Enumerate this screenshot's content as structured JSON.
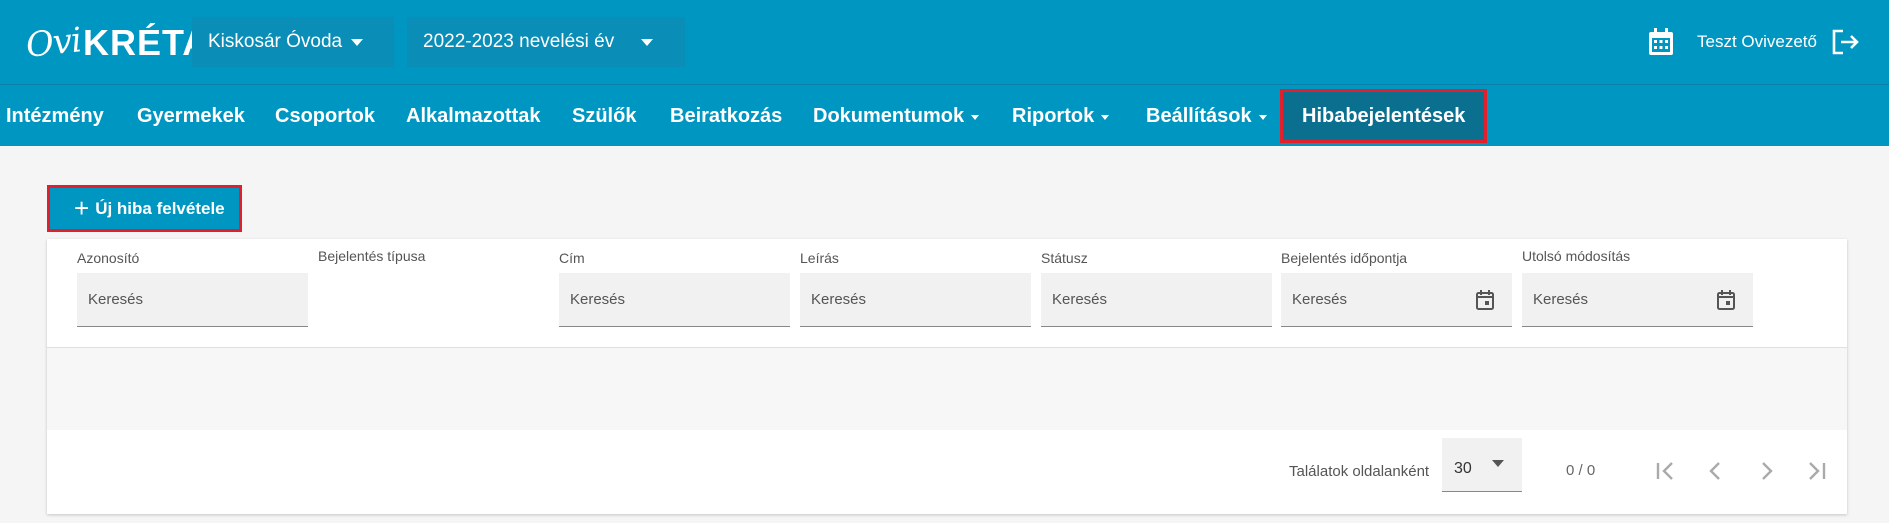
{
  "header": {
    "school_selector": "Kiskosár Óvoda",
    "year_selector": "2022-2023 nevelési év",
    "user_name": "Teszt Ovivezető",
    "logo_prefix": "Ovi",
    "logo_name": "KRÉTA"
  },
  "nav": {
    "items": [
      {
        "label": "Intézmény"
      },
      {
        "label": "Gyermekek"
      },
      {
        "label": "Csoportok"
      },
      {
        "label": "Alkalmazottak"
      },
      {
        "label": "Szülők"
      },
      {
        "label": "Beiratkozás"
      },
      {
        "label": "Dokumentumok"
      },
      {
        "label": "Riportok"
      },
      {
        "label": "Beállítások"
      },
      {
        "label": "Hibabejelentések"
      }
    ]
  },
  "toolbar": {
    "add_label": "Új hiba felvétele"
  },
  "table": {
    "columns": [
      {
        "label": "Azonosító",
        "placeholder": "Keresés"
      },
      {
        "label": "Bejelentés típusa",
        "placeholder": ""
      },
      {
        "label": "Cím",
        "placeholder": "Keresés"
      },
      {
        "label": "Leírás",
        "placeholder": "Keresés"
      },
      {
        "label": "Státusz",
        "placeholder": "Keresés"
      },
      {
        "label": "Bejelentés időpontja",
        "placeholder": "Keresés"
      },
      {
        "label": "Utolsó módosítás",
        "placeholder": "Keresés"
      }
    ]
  },
  "pager": {
    "per_page_label": "Találatok oldalanként",
    "per_page_value": "30",
    "count": "0 / 0"
  },
  "colors": {
    "primary": "#0096c2",
    "active_nav": "#0b6f8f",
    "highlight": "#e2202c"
  }
}
